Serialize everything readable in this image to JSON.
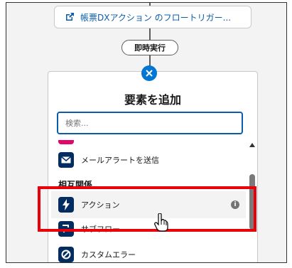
{
  "flow": {
    "trigger_label": "帳票DXアクション のフロートリガー...",
    "connector_label": "即時実行"
  },
  "panel": {
    "title": "要素を追加",
    "search_placeholder": "検索..."
  },
  "items": [
    {
      "label": "メールアラートを送信",
      "icon": "envelope-icon"
    },
    {
      "section": "相互関係"
    },
    {
      "label": "アクション",
      "icon": "lightning-icon"
    },
    {
      "label": "サブフロー",
      "icon": "subflow-icon"
    },
    {
      "label": "カスタムエラー",
      "icon": "error-icon"
    }
  ],
  "colors": {
    "brand_blue": "#0176d3",
    "icon_bg": "#032d60",
    "highlight": "#e8000b"
  }
}
